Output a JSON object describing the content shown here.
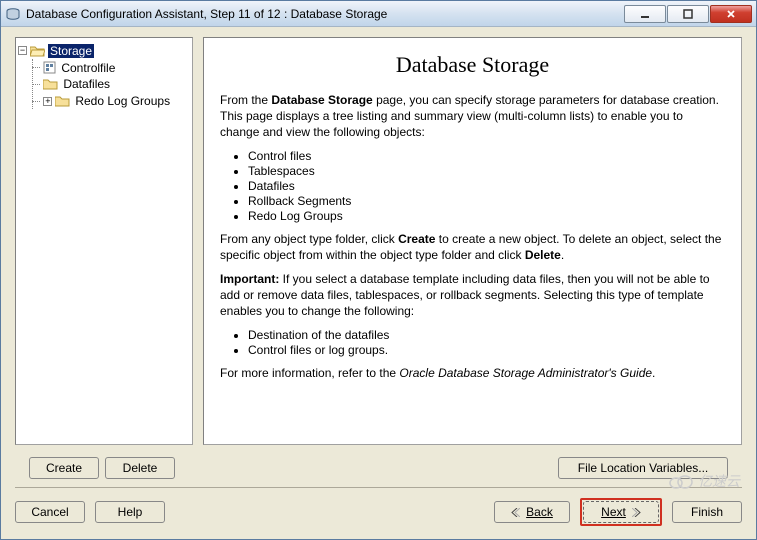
{
  "window": {
    "title": "Database Configuration Assistant, Step 11 of 12 : Database Storage"
  },
  "tree": {
    "root": {
      "label": "Storage",
      "children": {
        "controlfile": {
          "label": "Controlfile"
        },
        "datafiles": {
          "label": "Datafiles"
        },
        "redolog": {
          "label": "Redo Log Groups"
        }
      }
    }
  },
  "main": {
    "title": "Database Storage",
    "p1a": "From the ",
    "p1b": "Database Storage",
    "p1c": " page, you can specify storage parameters for database creation. This page displays a tree listing and summary view (multi-column lists) to enable you to change and view the following objects:",
    "list1": {
      "i1": "Control files",
      "i2": "Tablespaces",
      "i3": "Datafiles",
      "i4": "Rollback Segments",
      "i5": "Redo Log Groups"
    },
    "p2a": "From any object type folder, click ",
    "p2b": "Create",
    "p2c": " to create a new object. To delete an object, select the specific object from within the object type folder and click ",
    "p2d": "Delete",
    "p2e": ".",
    "p3a": "Important:",
    "p3b": " If you select a database template including data files, then you will not be able to add or remove data files, tablespaces, or rollback segments. Selecting this type of template enables you to change the following:",
    "list2": {
      "i1": "Destination of the datafiles",
      "i2": "Control files or log groups."
    },
    "p4a": "For more information, refer to the ",
    "p4b": "Oracle Database Storage Administrator's Guide",
    "p4c": "."
  },
  "buttons": {
    "create": "Create",
    "delete": "Delete",
    "fileloc": "File Location Variables...",
    "cancel": "Cancel",
    "help": "Help",
    "back": "Back",
    "next": "Next",
    "finish": "Finish"
  },
  "watermark": "亿速云"
}
